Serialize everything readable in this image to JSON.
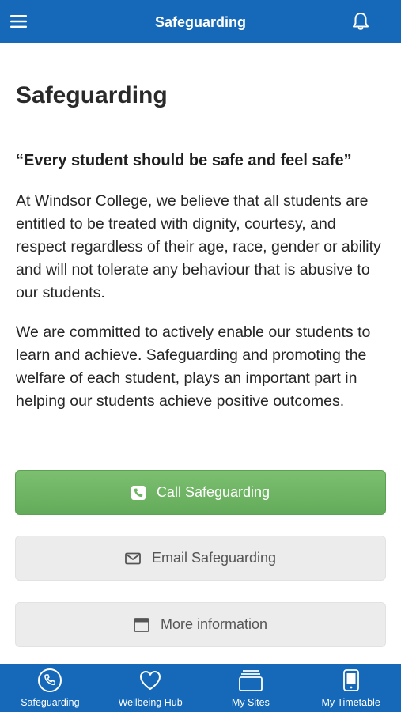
{
  "header": {
    "title": "Safeguarding",
    "menu_icon": "hamburger-menu-icon",
    "notification_icon": "bell-icon"
  },
  "page": {
    "title": "Safeguarding",
    "quote": "“Every student should be safe and feel safe”",
    "paragraphs": [
      "At Windsor College, we believe that all students are entitled to be treated with dignity, courtesy, and respect regardless of their age, race, gender or ability and will not tolerate any behaviour that is abusive to our students.",
      "We are committed to actively enable our students to learn and achieve. Safeguarding and promoting the welfare of each student, plays an important part in helping our students achieve positive outcomes."
    ]
  },
  "buttons": {
    "call": {
      "label": "Call Safeguarding",
      "icon": "phone-icon"
    },
    "email": {
      "label": "Email Safeguarding",
      "icon": "envelope-icon"
    },
    "more": {
      "label": "More information",
      "icon": "browser-window-icon"
    }
  },
  "tabbar": {
    "items": [
      {
        "label": "Safeguarding",
        "icon": "phone-circle-icon"
      },
      {
        "label": "Wellbeing Hub",
        "icon": "heart-icon"
      },
      {
        "label": "My Sites",
        "icon": "stacked-cards-icon"
      },
      {
        "label": "My Timetable",
        "icon": "device-icon"
      }
    ]
  },
  "colors": {
    "brand_blue": "#1569b8",
    "call_green": "#6db463",
    "secondary_button": "#ececec"
  }
}
